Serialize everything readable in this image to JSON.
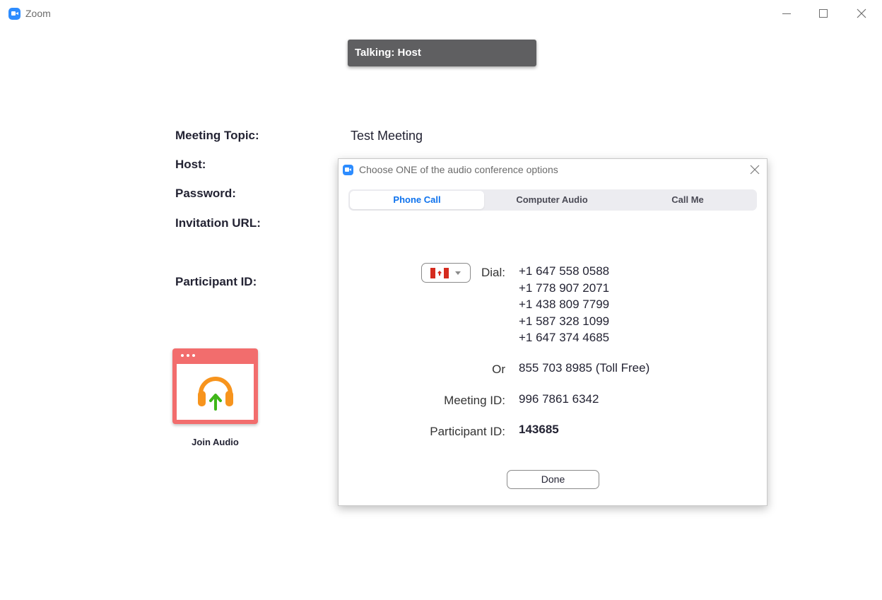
{
  "window": {
    "title": "Zoom"
  },
  "banner": {
    "talking": "Talking: Host"
  },
  "meeting": {
    "topic_label": "Meeting Topic:",
    "topic_value": "Test Meeting",
    "host_label": "Host:",
    "password_label": "Password:",
    "url_label": "Invitation URL:",
    "participant_label": "Participant ID:"
  },
  "join_audio": {
    "label": "Join Audio",
    "icon": "headphones-upload-icon",
    "colors": {
      "tile": "#f26d6d",
      "headphones": "#f7941d",
      "arrow": "#3fb618"
    }
  },
  "dialog": {
    "title": "Choose ONE of the audio conference options",
    "tabs": [
      {
        "label": "Phone Call",
        "active": true
      },
      {
        "label": "Computer Audio",
        "active": false
      },
      {
        "label": "Call Me",
        "active": false
      }
    ],
    "country": "Canada",
    "dial_label": "Dial:",
    "dial_numbers": [
      "+1 647 558 0588",
      "+1 778 907 2071",
      "+1 438 809 7799",
      "+1 587 328 1099",
      "+1 647 374 4685"
    ],
    "or_label": "Or",
    "toll_free": "855 703 8985 (Toll Free)",
    "meeting_id_label": "Meeting ID:",
    "meeting_id": "996 7861 6342",
    "participant_id_label": "Participant ID:",
    "participant_id": "143685",
    "done_label": "Done",
    "accent": "#0e72ed"
  }
}
